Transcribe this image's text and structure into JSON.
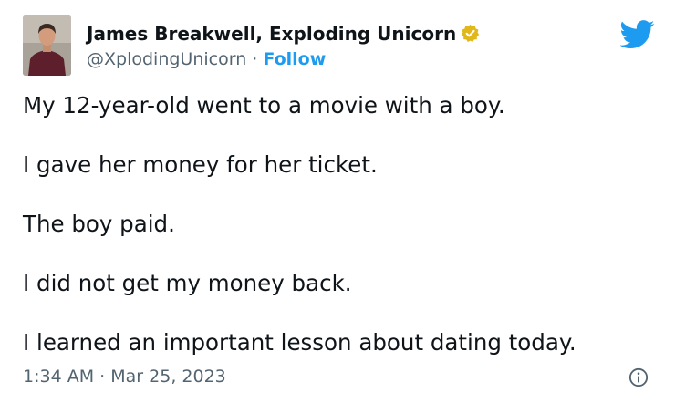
{
  "tweet": {
    "author": {
      "display_name": "James Breakwell, Exploding Unicorn",
      "handle": "@XplodingUnicorn",
      "separator": "·",
      "follow_label": "Follow"
    },
    "lines": [
      "My 12-year-old went to a movie with a boy.",
      "I gave her money for her ticket.",
      "The boy paid.",
      "I did not get my money back.",
      "I learned an important lesson about dating today."
    ],
    "timestamp": {
      "time": "1:34 AM",
      "separator": "·",
      "date": "Mar 25, 2023"
    }
  },
  "icons": {
    "verified": "verified-badge-icon",
    "platform": "twitter-bird-icon",
    "info": "info-icon"
  },
  "colors": {
    "text": "#0f1419",
    "secondary": "#536471",
    "accent": "#1d9bf0",
    "verified_badge": "#e2b719"
  }
}
